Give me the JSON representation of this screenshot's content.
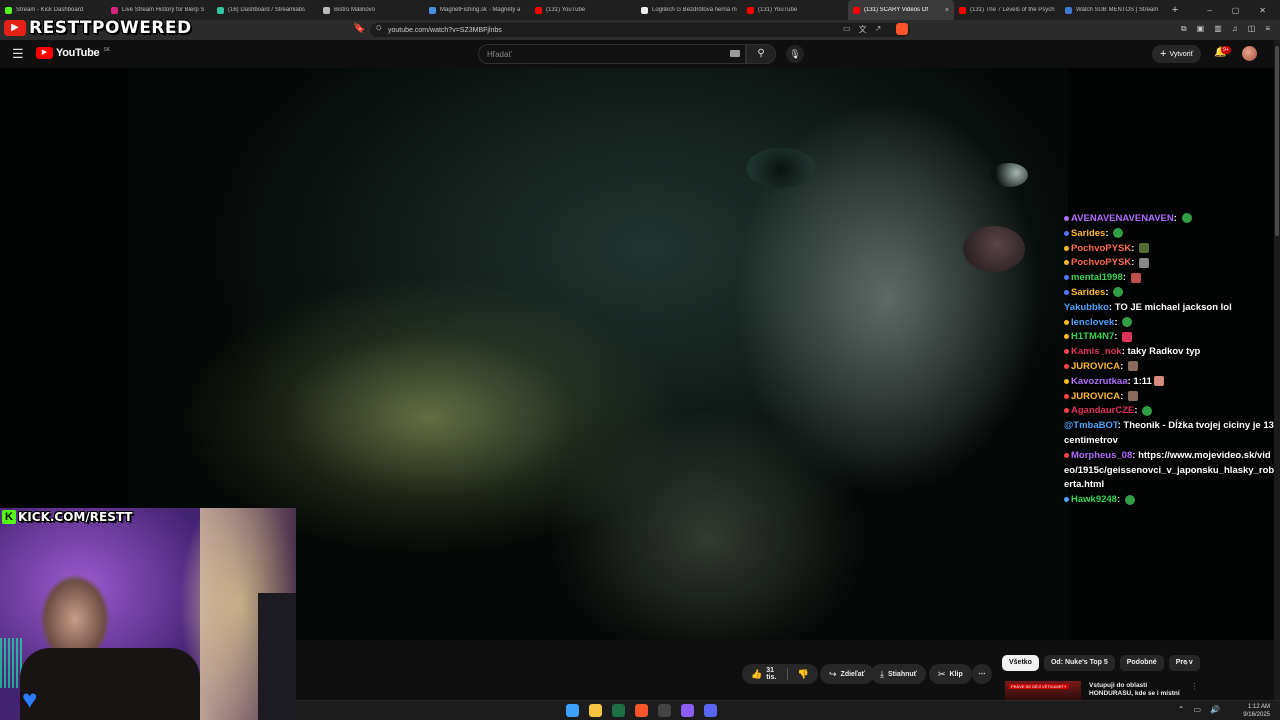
{
  "browser": {
    "tabs": [
      {
        "title": "Stream - Kick Dashboard",
        "color": "#53fc18",
        "active": false
      },
      {
        "title": "Live Stream History for Blerp S",
        "color": "#d6247c",
        "active": false
      },
      {
        "title": "(16) Dashboard / Streamlabs",
        "color": "#31c3a2",
        "active": false
      },
      {
        "title": "Bistro Malinovo",
        "color": "#bbbbbb",
        "active": false
      },
      {
        "title": "MagnetFishing.sk - Magnety a",
        "color": "#4a90e2",
        "active": false
      },
      {
        "title": "(131) YouTube",
        "color": "#ff0000",
        "active": false
      },
      {
        "title": "Logitech G Bezdrôtová herná m",
        "color": "#eeeeee",
        "active": false
      },
      {
        "title": "(131) YouTube",
        "color": "#ff0000",
        "active": false
      },
      {
        "title": "(131) SCARY Videos Of",
        "color": "#ff0000",
        "active": true
      },
      {
        "title": "(131) The 7 Levels of the Psych",
        "color": "#ff0000",
        "active": false
      },
      {
        "title": "Watch SUB MENTOS | Stream",
        "color": "#3a7bd5",
        "active": false
      }
    ],
    "tab_close": "×",
    "new_tab": "+",
    "window_controls": [
      "–",
      "▢",
      "✕"
    ],
    "url": "youtube.com/watch?v=SZ3MBFjlnbs"
  },
  "overlay": {
    "logo_text": "RESTTPOWERED",
    "kick_text": "KICK.COM/RESTT"
  },
  "youtube": {
    "wordmark": "YouTube",
    "country": "SK",
    "search_placeholder": "Hľadať",
    "create_label": "Vytvoriť",
    "notifications_badge": "9+"
  },
  "chat": [
    {
      "user": "AVENAVENAVENAVEN",
      "text": "",
      "color": "#b06cff",
      "dot": "#b06cff",
      "emote": "#2f9e44"
    },
    {
      "user": "Sarides",
      "text": "",
      "color": "#ffb92e",
      "dot": "#5577ff",
      "emote": "#2f9e44"
    },
    {
      "user": "PochvoPYSK",
      "text": "",
      "color": "#ff6b4a",
      "dot": "#ffb92e",
      "emote": "#556b2f"
    },
    {
      "user": "PochvoPYSK",
      "text": "",
      "color": "#ff6b4a",
      "dot": "#ffb92e",
      "emote": "#888888"
    },
    {
      "user": "mental1998",
      "text": "",
      "color": "#39d353",
      "dot": "#5577ff",
      "emote": "#c0504d"
    },
    {
      "user": "Sarides",
      "text": "",
      "color": "#ffb92e",
      "dot": "#5577ff",
      "emote": "#2f9e44"
    },
    {
      "user": "Yakubbko",
      "text": "TO JE michael jackson lol",
      "color": "#4da3ff",
      "dot": "",
      "emote": ""
    },
    {
      "user": "lenclovek",
      "text": "",
      "color": "#4da3ff",
      "dot": "#ffb92e",
      "emote": "#2f9e44"
    },
    {
      "user": "H1TM4N7",
      "text": "",
      "color": "#39d353",
      "dot": "#ffb92e",
      "emote": "#e0335a"
    },
    {
      "user": "Kamis_nok",
      "text": "taky Radkov typ",
      "color": "#e0335a",
      "dot": "#ff4444",
      "emote": ""
    },
    {
      "user": "JUROVICA",
      "text": "",
      "color": "#ffb92e",
      "dot": "#ff4444",
      "emote": "#8a6a5a"
    },
    {
      "user": "Kavozrutkaa",
      "text": "1:11",
      "color": "#b06cff",
      "dot": "#ffb92e",
      "emote": "#d98a7a"
    },
    {
      "user": "JUROVICA",
      "text": "",
      "color": "#ffb92e",
      "dot": "#ff4444",
      "emote": "#8a6a5a"
    },
    {
      "user": "AgandaurCZE",
      "text": "",
      "color": "#e0335a",
      "dot": "#ff4444",
      "emote": "#2f9e44"
    },
    {
      "user": "@TmbaBOT",
      "text": "Theonik - Dĺžka tvojej ciciny je 13 centimetrov",
      "color": "#4da3ff",
      "dot": "",
      "emote": ""
    },
    {
      "user": "Morpheus_08",
      "text": "https://www.mojevideo.sk/video/1915c/geissenovci_v_japonsku_hlasky_roberta.html",
      "color": "#b06cff",
      "dot": "#ff4444",
      "emote": ""
    },
    {
      "user": "Hawk9248",
      "text": "",
      "color": "#39d353",
      "dot": "#4da3ff",
      "emote": "#2f9e44"
    }
  ],
  "actions": {
    "likes": "31 tis.",
    "share": "Zdieľať",
    "download": "Stiahnuť",
    "clip": "Klip",
    "more": "⋯"
  },
  "chips": [
    "Všetko",
    "Od: Nuke's Top 5",
    "Podobné",
    "Pre v"
  ],
  "related": {
    "thumb_text": "PRÁVE SE DĚJÍ VĚTVUMRTY",
    "title": "Vstupuji do oblasti HONDURASU, kde se i místní"
  },
  "taskbar": {
    "apps": [
      {
        "name": "windows-start",
        "color": "#3ba3ff"
      },
      {
        "name": "file-explorer",
        "color": "#f5c542"
      },
      {
        "name": "excel",
        "color": "#1d7044"
      },
      {
        "name": "brave",
        "color": "#fb542b"
      },
      {
        "name": "obs",
        "color": "#444444"
      },
      {
        "name": "streamlabs",
        "color": "#8b5cf6"
      },
      {
        "name": "discord",
        "color": "#5865f2"
      }
    ],
    "time": "1:12 AM",
    "date": "9/16/2025"
  }
}
